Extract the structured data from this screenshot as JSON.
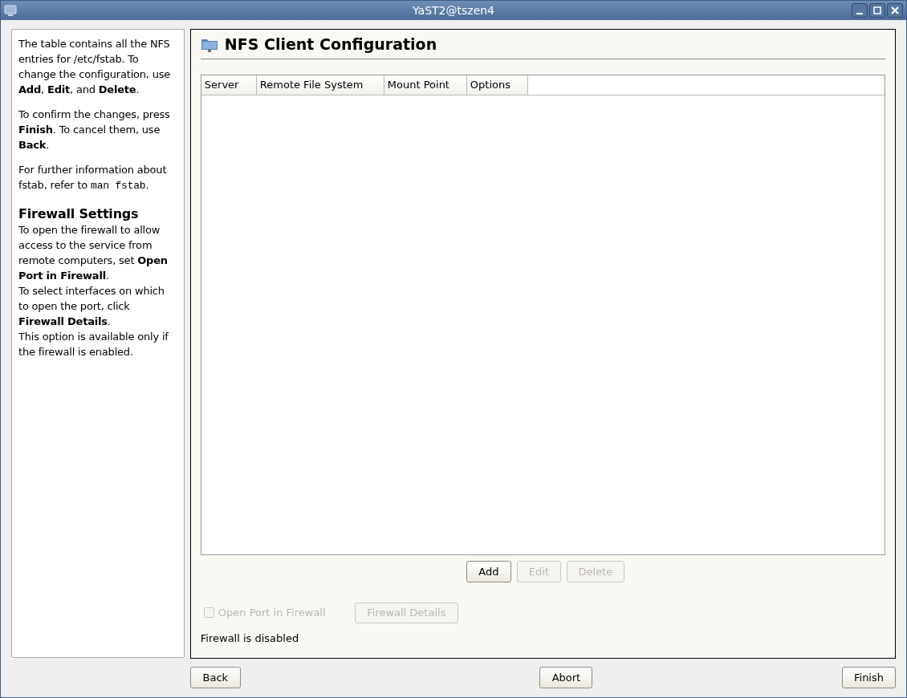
{
  "window": {
    "title": "YaST2@tszen4"
  },
  "help": {
    "paragraphs": [
      {
        "text": "The table contains all the NFS entries for /etc/fstab. To change the configuration, use **Add**, **Edit**, and **Delete**."
      },
      {
        "text": "To confirm the changes, press **Finish**. To cancel them, use **Back**."
      },
      {
        "text": "For further information about fstab, refer to ",
        "code": "man fstab",
        "tail": "."
      }
    ],
    "heading": "Firewall Settings",
    "lines": [
      "To open the firewall to allow access to the service from remote computers, set **Open Port in Firewall**.",
      "To select interfaces on which to open the port, click **Firewall Details**.",
      "This option is available only if the firewall is enabled."
    ]
  },
  "page": {
    "title": "NFS Client Configuration"
  },
  "table": {
    "columns": [
      "Server",
      "Remote File System",
      "Mount Point",
      "Options"
    ]
  },
  "table_buttons": [
    {
      "label": "Add",
      "disabled": false
    },
    {
      "label": "Edit",
      "disabled": true
    },
    {
      "label": "Delete",
      "disabled": true
    }
  ],
  "firewall": {
    "checkbox": {
      "label": "Open Port in Firewall",
      "checked": false,
      "disabled": true
    },
    "details_button": {
      "label": "Firewall Details",
      "disabled": true
    },
    "status": "Firewall is disabled"
  },
  "nav_buttons": [
    {
      "label": "Back"
    },
    {
      "label": "Abort"
    },
    {
      "label": "Finish"
    }
  ]
}
